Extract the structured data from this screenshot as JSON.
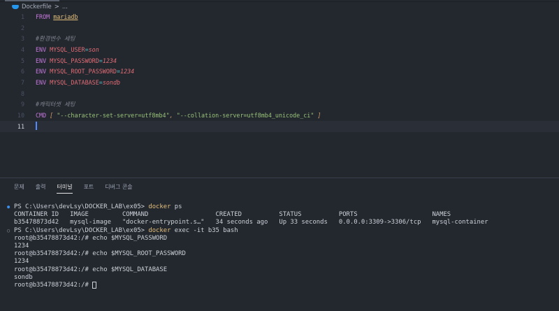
{
  "breadcrumb": {
    "file": "Dockerfile",
    "sep": ">",
    "rest": "..."
  },
  "editor": {
    "lines": [
      {
        "n": "1",
        "t": [
          [
            "kw",
            "FROM "
          ],
          [
            "img",
            "mariadb"
          ]
        ]
      },
      {
        "n": "2",
        "t": []
      },
      {
        "n": "3",
        "t": [
          [
            "cm",
            "#환경변수 세팅"
          ]
        ]
      },
      {
        "n": "4",
        "t": [
          [
            "kw",
            "ENV "
          ],
          [
            "var",
            "MYSQL_USER"
          ],
          [
            "op",
            "="
          ],
          [
            "val",
            "son"
          ]
        ]
      },
      {
        "n": "5",
        "t": [
          [
            "kw",
            "ENV "
          ],
          [
            "var",
            "MYSQL_PASSWORD"
          ],
          [
            "op",
            "="
          ],
          [
            "val",
            "1234"
          ]
        ]
      },
      {
        "n": "6",
        "t": [
          [
            "kw",
            "ENV "
          ],
          [
            "var",
            "MYSQL_ROOT_PASSWORD"
          ],
          [
            "op",
            "="
          ],
          [
            "val",
            "1234"
          ]
        ]
      },
      {
        "n": "7",
        "t": [
          [
            "kw",
            "ENV "
          ],
          [
            "var",
            "MYSQL_DATABASE"
          ],
          [
            "op",
            "="
          ],
          [
            "val",
            "sondb"
          ]
        ]
      },
      {
        "n": "8",
        "t": []
      },
      {
        "n": "9",
        "t": [
          [
            "cm",
            "#캐릭터셋 세팅"
          ]
        ]
      },
      {
        "n": "10",
        "t": [
          [
            "kw",
            "CMD "
          ],
          [
            "br",
            "[ "
          ],
          [
            "str",
            "\"--character-set-server=utf8mb4\""
          ],
          [
            "br",
            ", "
          ],
          [
            "str",
            "\"--collation-server=utf8mb4_unicode_ci\""
          ],
          [
            "br",
            " ]"
          ]
        ]
      },
      {
        "n": "11",
        "t": [],
        "current": true
      }
    ]
  },
  "panel": {
    "tabs": [
      "문제",
      "출력",
      "터미널",
      "포트",
      "디버그 콘솔"
    ],
    "active": 2
  },
  "terminal": {
    "lines": [
      {
        "dot": "b",
        "t": [
          [
            "",
            "PS C:\\Users\\devLsy\\DOCKER_LAB\\ex05> "
          ],
          [
            "cmd",
            "docker"
          ],
          [
            "",
            " ps"
          ]
        ]
      },
      {
        "t": [
          [
            "",
            "CONTAINER ID   IMAGE         COMMAND                  CREATED          STATUS          PORTS                    NAMES"
          ]
        ]
      },
      {
        "t": [
          [
            "",
            "b35478873d42   mysql-image   \"docker-entrypoint.s…\"   34 seconds ago   Up 33 seconds   0.0.0.0:3309->3306/tcp   mysql-container"
          ]
        ]
      },
      {
        "dot": "o",
        "t": [
          [
            "",
            "PS C:\\Users\\devLsy\\DOCKER_LAB\\ex05> "
          ],
          [
            "cmd",
            "docker"
          ],
          [
            "",
            " exec -it b35 bash"
          ]
        ]
      },
      {
        "t": [
          [
            "",
            "root@b35478873d42:/# echo $MYSQL_PASSWORD"
          ]
        ]
      },
      {
        "t": [
          [
            "",
            "1234"
          ]
        ]
      },
      {
        "t": [
          [
            "",
            "root@b35478873d42:/# echo $MYSQL_ROOT_PASSWORD"
          ]
        ]
      },
      {
        "t": [
          [
            "",
            "1234"
          ]
        ]
      },
      {
        "t": [
          [
            "",
            "root@b35478873d42:/# echo $MYSQL_DATABASE"
          ]
        ]
      },
      {
        "t": [
          [
            "",
            "sondb"
          ]
        ]
      },
      {
        "t": [
          [
            "",
            "root@b35478873d42:/# "
          ]
        ],
        "cursor": true
      }
    ]
  }
}
